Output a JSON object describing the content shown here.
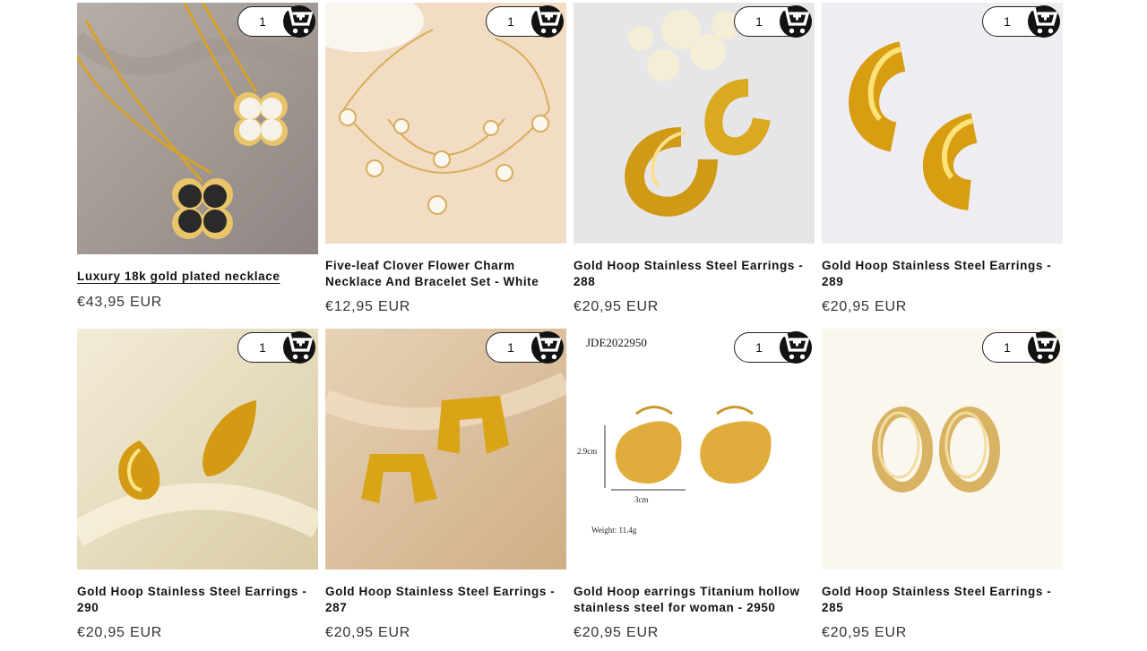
{
  "colors": {
    "cart_button": "#121212",
    "price_text": "#333333",
    "title_text": "#121212"
  },
  "cart_icon": "cart-plus-icon",
  "products": [
    {
      "title": "Luxury 18k gold plated necklace",
      "price": "€43,95 EUR",
      "qty": "1"
    },
    {
      "title": "Five-leaf Clover Flower Charm Necklace And Bracelet Set - White",
      "price": "€12,95 EUR",
      "qty": "1"
    },
    {
      "title": "Gold Hoop Stainless Steel Earrings - 288",
      "price": "€20,95 EUR",
      "qty": "1"
    },
    {
      "title": "Gold Hoop Stainless Steel Earrings - 289",
      "price": "€20,95 EUR",
      "qty": "1"
    },
    {
      "title": "Gold Hoop Stainless Steel Earrings - 290",
      "price": "€20,95 EUR",
      "qty": "1"
    },
    {
      "title": "Gold Hoop Stainless Steel Earrings - 287",
      "price": "€20,95 EUR",
      "qty": "1"
    },
    {
      "title": "Gold Hoop earrings Titanium hollow stainless steel for woman - 2950",
      "price": "€20,95 EUR",
      "qty": "1"
    },
    {
      "title": "Gold Hoop Stainless Steel Earrings - 285",
      "price": "€20,95 EUR",
      "qty": "1"
    }
  ],
  "photo_text": {
    "code": "JDE2022950",
    "height": "2.9cm",
    "width": "3cm",
    "weight": "Weight:  11.4g"
  }
}
